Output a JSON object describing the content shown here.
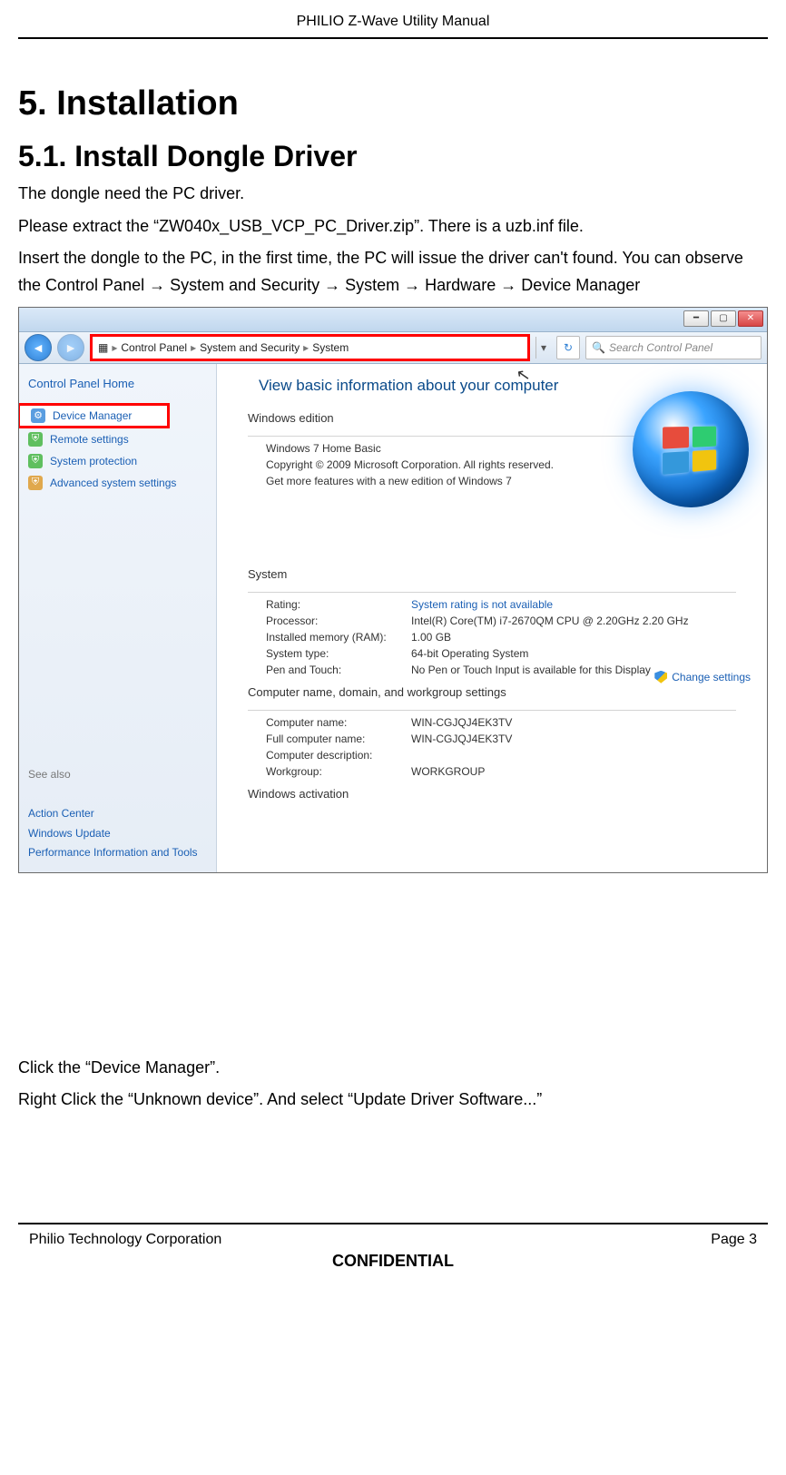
{
  "doc": {
    "header": "PHILIO Z-Wave Utility Manual",
    "footer_left": "Philio Technology Corporation",
    "footer_right": "Page 3",
    "confidential": "CONFIDENTIAL"
  },
  "headings": {
    "h1": "5.   Installation",
    "h2": "5.1. Install Dongle Driver"
  },
  "paragraphs": {
    "p1": "The dongle need the PC driver.",
    "p2": "Please extract the “ZW040x_USB_VCP_PC_Driver.zip”. There is a uzb.inf file.",
    "p3": "Insert the dongle to the PC, in the first time, the PC will issue the driver can't found. You can observe the Control Panel → System and Security → System → Hardware → Device Manager",
    "p4": "Click the “Device Manager”.",
    "p5": "Right Click the “Unknown device”. And select “Update Driver Software...”"
  },
  "screenshot": {
    "breadcrumb": {
      "c1": "Control Panel",
      "c2": "System and Security",
      "c3": "System"
    },
    "search_placeholder": "Search Control Panel",
    "left": {
      "home": "Control Panel Home",
      "device_manager": "Device Manager",
      "remote": "Remote settings",
      "protection": "System protection",
      "advanced": "Advanced system settings",
      "see_also": "See also",
      "action_center": "Action Center",
      "windows_update": "Windows Update",
      "perf": "Performance Information and Tools"
    },
    "right": {
      "title": "View basic information about your computer",
      "edition_hdr": "Windows edition",
      "edition_name": "Windows 7 Home Basic",
      "copyright": "Copyright © 2009 Microsoft Corporation. All rights reserved.",
      "more_features": "Get more features with a new edition of Windows 7",
      "system_hdr": "System",
      "rating_lbl": "Rating:",
      "rating_val": "System rating is not available",
      "processor_lbl": "Processor:",
      "processor_val": "Intel(R) Core(TM) i7-2670QM CPU @ 2.20GHz  2.20 GHz",
      "ram_lbl": "Installed memory (RAM):",
      "ram_val": "1.00 GB",
      "systype_lbl": "System type:",
      "systype_val": "64-bit Operating System",
      "pen_lbl": "Pen and Touch:",
      "pen_val": "No Pen or Touch Input is available for this Display",
      "cnd_hdr": "Computer name, domain, and workgroup settings",
      "cname_lbl": "Computer name:",
      "cname_val": "WIN-CGJQJ4EK3TV",
      "fcname_lbl": "Full computer name:",
      "fcname_val": "WIN-CGJQJ4EK3TV",
      "cdesc_lbl": "Computer description:",
      "cdesc_val": "",
      "wg_lbl": "Workgroup:",
      "wg_val": "WORKGROUP",
      "change_settings": "Change settings",
      "activation_hdr": "Windows activation"
    }
  }
}
